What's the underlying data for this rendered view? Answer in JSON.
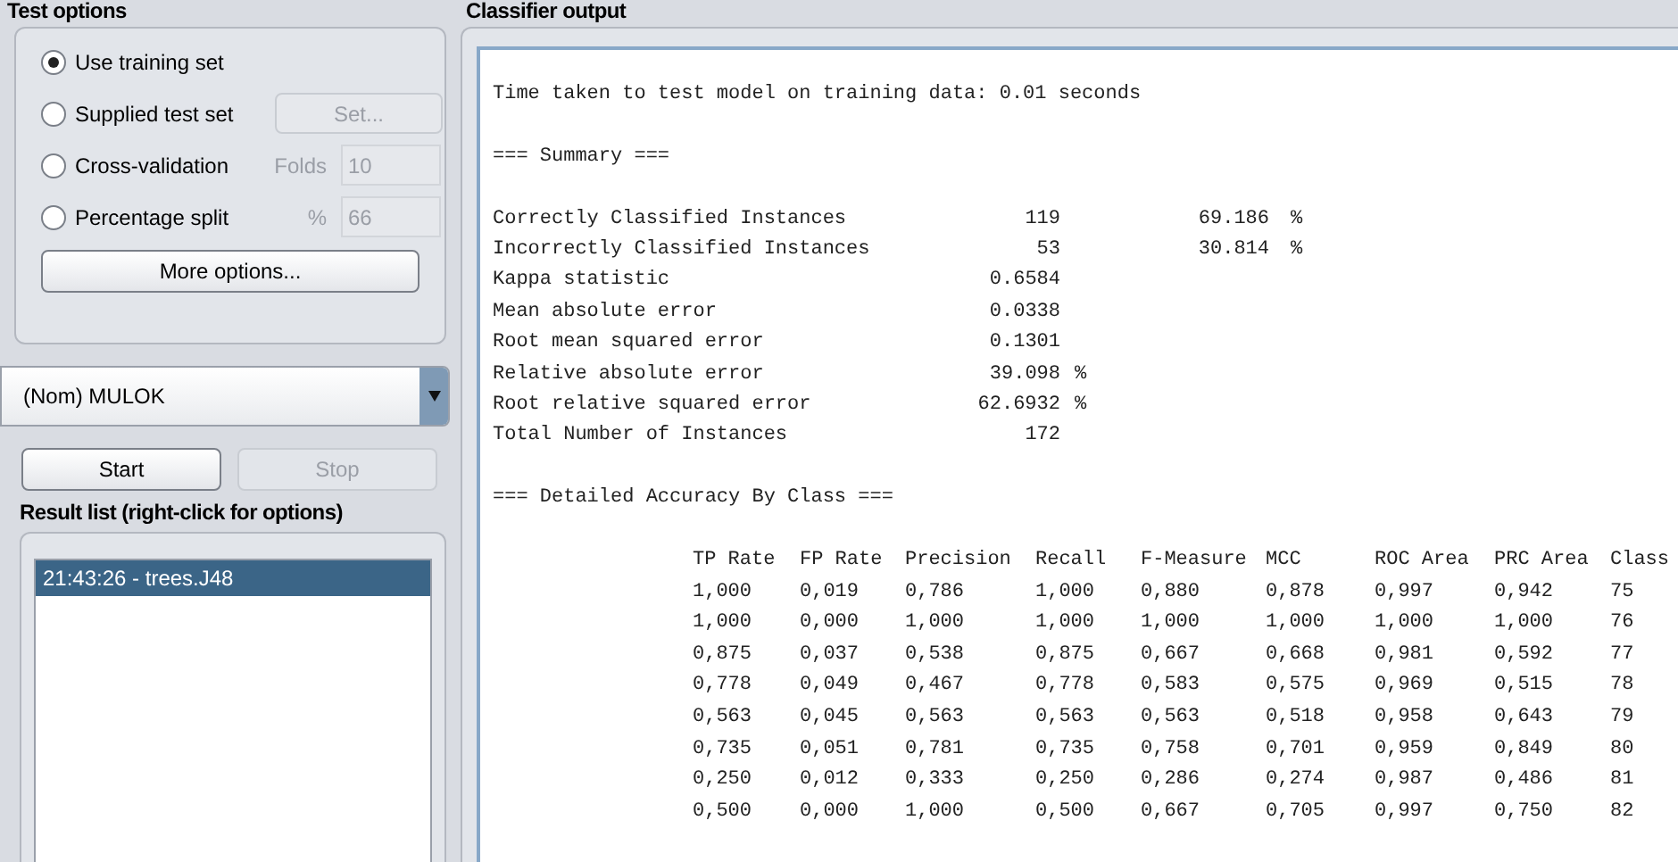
{
  "test_options": {
    "title": "Test options",
    "options": [
      {
        "label": "Use training set",
        "selected": true
      },
      {
        "label": "Supplied test set",
        "selected": false,
        "control": {
          "kind": "button",
          "label": "Set...",
          "disabled": true
        }
      },
      {
        "label": "Cross-validation",
        "selected": false,
        "control": {
          "kind": "field",
          "label": "Folds",
          "value": "10",
          "disabled": true
        }
      },
      {
        "label": "Percentage split",
        "selected": false,
        "control": {
          "kind": "field",
          "label": "%",
          "value": "66",
          "disabled": true
        }
      }
    ],
    "more_button": "More options..."
  },
  "class_selector": {
    "value": "(Nom) MULOK"
  },
  "actions": [
    {
      "label": "Start",
      "disabled": false
    },
    {
      "label": "Stop",
      "disabled": true
    }
  ],
  "result_list": {
    "title": "Result list (right-click for options)",
    "items": [
      {
        "label": "21:43:26 - trees.J48",
        "selected": true
      }
    ]
  },
  "classifier_output": {
    "title": "Classifier output",
    "time_line": "Time taken to test model on training data: 0.01 seconds",
    "summary_heading": "=== Summary ===",
    "summary": [
      {
        "label": "Correctly Classified Instances",
        "value": "119",
        "percent": "69.186",
        "percent_unit": "%"
      },
      {
        "label": "Incorrectly Classified Instances",
        "value": "53",
        "percent": "30.814",
        "percent_unit": "%"
      },
      {
        "label": "Kappa statistic",
        "value": "0.6584"
      },
      {
        "label": "Mean absolute error",
        "value": "0.0338"
      },
      {
        "label": "Root mean squared error",
        "value": "0.1301"
      },
      {
        "label": "Relative absolute error",
        "value": "39.098",
        "unit": "%"
      },
      {
        "label": "Root relative squared error",
        "value": "62.6932",
        "unit": "%"
      },
      {
        "label": "Total Number of Instances",
        "value": "172"
      }
    ],
    "detail_heading": "=== Detailed Accuracy By Class ===",
    "columns": [
      "TP Rate",
      "FP Rate",
      "Precision",
      "Recall",
      "F-Measure",
      "MCC",
      "ROC Area",
      "PRC Area",
      "Class"
    ],
    "rows": [
      [
        "1,000",
        "0,019",
        "0,786",
        "1,000",
        "0,880",
        "0,878",
        "0,997",
        "0,942",
        "75"
      ],
      [
        "1,000",
        "0,000",
        "1,000",
        "1,000",
        "1,000",
        "1,000",
        "1,000",
        "1,000",
        "76"
      ],
      [
        "0,875",
        "0,037",
        "0,538",
        "0,875",
        "0,667",
        "0,668",
        "0,981",
        "0,592",
        "77"
      ],
      [
        "0,778",
        "0,049",
        "0,467",
        "0,778",
        "0,583",
        "0,575",
        "0,969",
        "0,515",
        "78"
      ],
      [
        "0,563",
        "0,045",
        "0,563",
        "0,563",
        "0,563",
        "0,518",
        "0,958",
        "0,643",
        "79"
      ],
      [
        "0,735",
        "0,051",
        "0,781",
        "0,735",
        "0,758",
        "0,701",
        "0,959",
        "0,849",
        "80"
      ],
      [
        "0,250",
        "0,012",
        "0,333",
        "0,250",
        "0,286",
        "0,274",
        "0,987",
        "0,486",
        "81"
      ],
      [
        "0,500",
        "0,000",
        "1,000",
        "0,500",
        "0,667",
        "0,705",
        "0,997",
        "0,750",
        "82"
      ]
    ]
  }
}
